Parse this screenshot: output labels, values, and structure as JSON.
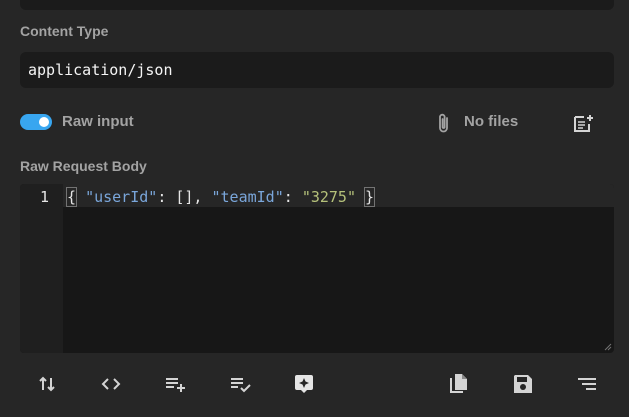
{
  "top_strip": {},
  "content_type": {
    "label": "Content Type",
    "value": "application/json"
  },
  "raw_input": {
    "label": "Raw input",
    "enabled": true,
    "accent_color": "#38a6f0"
  },
  "attachments": {
    "status": "No files",
    "icon": "paperclip-icon",
    "add_icon": "add-note-icon"
  },
  "raw_body": {
    "label": "Raw Request Body",
    "line_numbers": [
      "1"
    ],
    "code_tokens": {
      "open_brace": "{",
      "sp1": " ",
      "key1": "\"userId\"",
      "sep1": ": [], ",
      "key2": "\"teamId\"",
      "sep2": ": ",
      "val2": "\"3275\"",
      "sp2": " ",
      "close_brace": "}"
    }
  },
  "toolbar": {
    "icons": [
      "swap-vertical-icon",
      "code-brackets-icon",
      "playlist-add-icon",
      "playlist-check-icon",
      "magic-sparkle-icon",
      "copy-icon",
      "save-icon",
      "format-lines-icon"
    ]
  }
}
